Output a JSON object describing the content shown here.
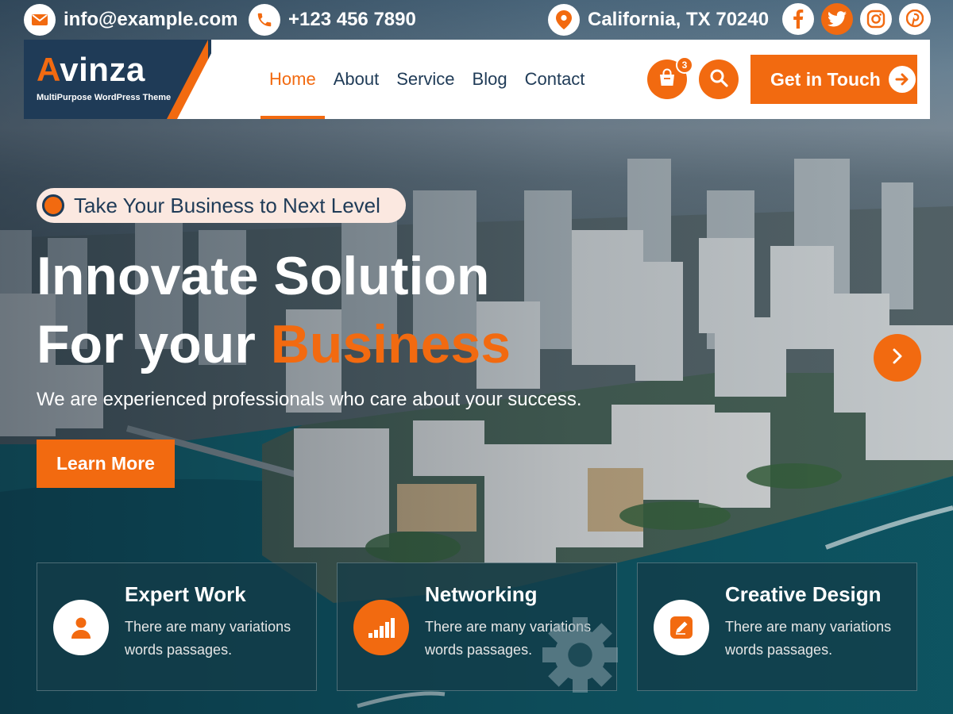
{
  "topbar": {
    "email": "info@example.com",
    "phone": "+123 456 7890",
    "location": "California, TX 70240",
    "icons": {
      "email": "envelope-icon",
      "phone": "phone-icon",
      "location": "map-pin-icon"
    }
  },
  "social": [
    {
      "name": "facebook",
      "icon": "facebook-icon",
      "glyph": "f",
      "active": false
    },
    {
      "name": "twitter",
      "icon": "twitter-icon",
      "glyph": "t",
      "active": true
    },
    {
      "name": "instagram",
      "icon": "instagram-icon",
      "glyph": "ig",
      "active": false
    },
    {
      "name": "pinterest",
      "icon": "pinterest-icon",
      "glyph": "p",
      "active": false
    }
  ],
  "header": {
    "logo_first": "A",
    "logo_rest": "vinza",
    "tagline": "MultiPurpose WordPress Theme",
    "nav": [
      "Home",
      "About",
      "Service",
      "Blog",
      "Contact"
    ],
    "active_nav": "Home",
    "cart_count": "3",
    "cta_label": "Get in Touch"
  },
  "hero": {
    "pill_text": "Take Your Business to Next Level",
    "title_line1": "Innovate Solution",
    "title_line2_plain": "For your ",
    "title_line2_accent": "Business",
    "subtitle": "We are experienced professionals who care about your success.",
    "button_label": "Learn More"
  },
  "features": [
    {
      "title": "Expert Work",
      "text": "There are many variations words passages.",
      "icon": "user-icon"
    },
    {
      "title": "Networking",
      "text": "There are many variations words passages.",
      "icon": "signal-bars-icon"
    },
    {
      "title": "Creative Design",
      "text": "There are many variations words passages.",
      "icon": "edit-icon"
    }
  ],
  "colors": {
    "accent": "#f26a10",
    "navy": "#1f3b57",
    "white": "#ffffff"
  }
}
